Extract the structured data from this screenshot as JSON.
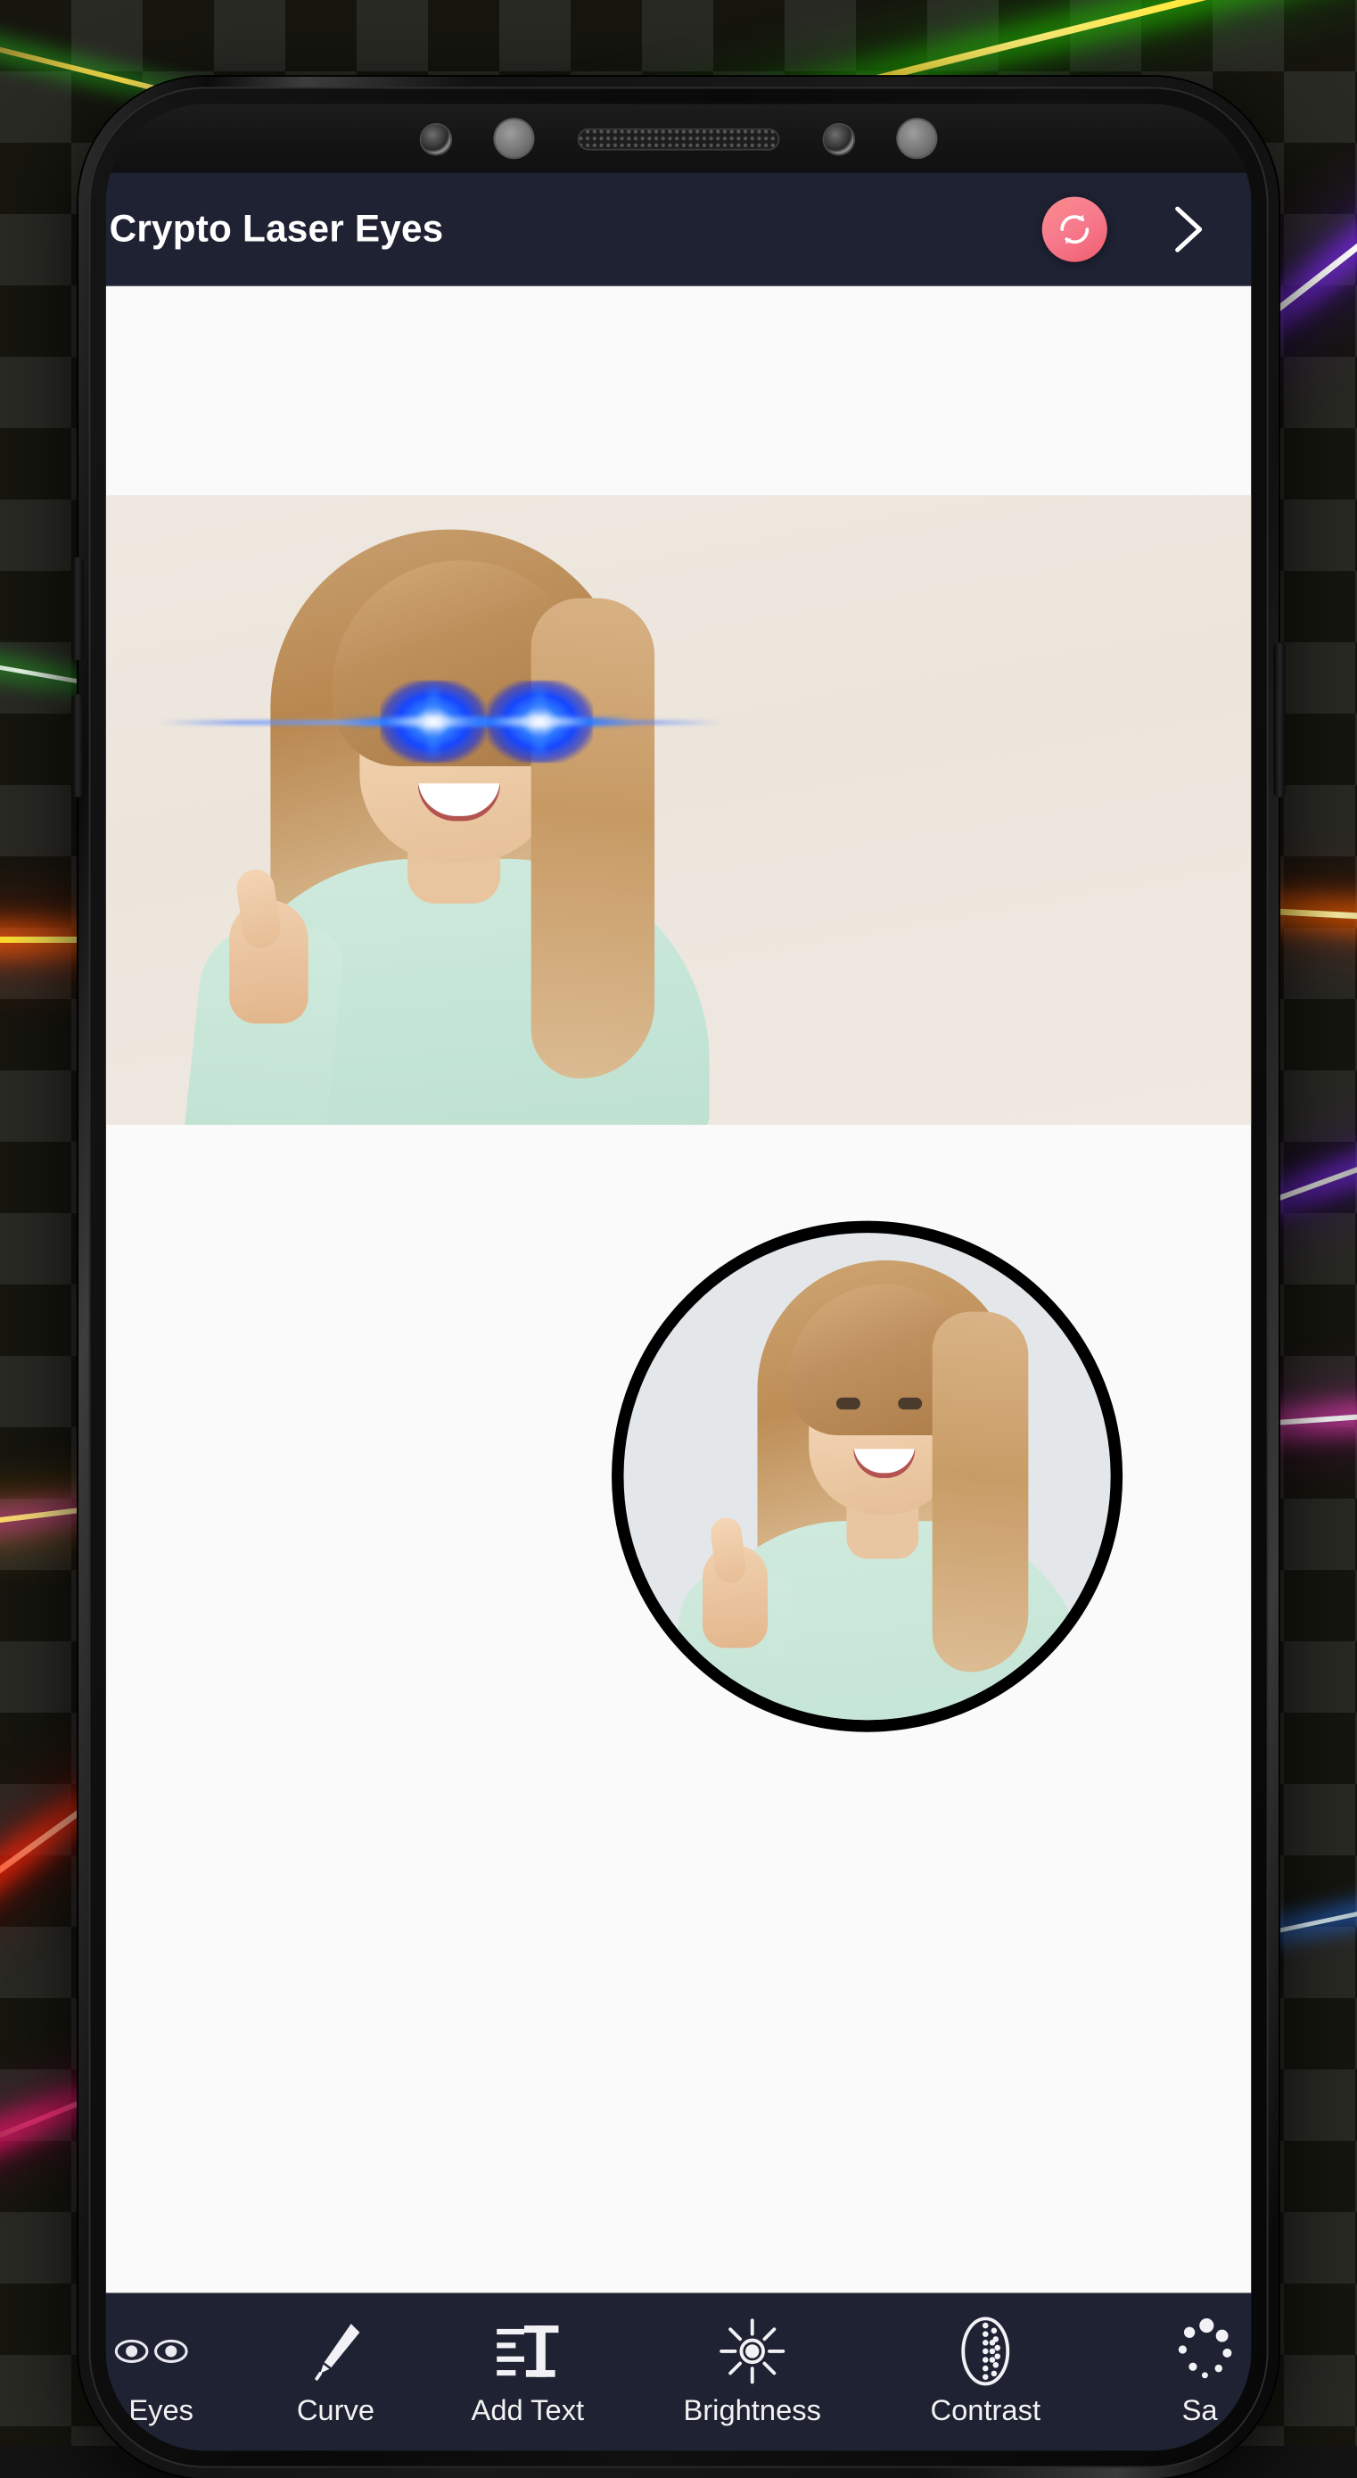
{
  "app": {
    "title": "Crypto Laser Eyes",
    "header_bg": "#1f2233",
    "refresh_color": "#f4707f",
    "accent": "#ef5f6f"
  },
  "header": {
    "title": "Crypto Laser Eyes",
    "refresh_icon": "refresh-icon",
    "next_icon": "chevron-right-icon",
    "refresh_label": "Refresh",
    "next_label": "Next"
  },
  "device": {
    "bezel_sensors": [
      "camera-sensor",
      "proximity-sensor",
      "earpiece-speaker",
      "camera-sensor",
      "light-sensor"
    ]
  },
  "canvas": {
    "background": "#fafafa",
    "photo_background": "#ece5dc",
    "effect": "laser-eyes",
    "effect_color": "#1546ff"
  },
  "thumbnail": {
    "name": "original-photo-preview",
    "border_color": "#000000"
  },
  "toolbar": {
    "background": "#1f2233",
    "items": [
      {
        "label": "Laser Eyes",
        "icon": "eyes-icon",
        "visible_label": "r Eyes"
      },
      {
        "label": "Curve",
        "icon": "pen-icon",
        "visible_label": "Curve"
      },
      {
        "label": "Add Text",
        "icon": "text-icon",
        "visible_label": "Add Text"
      },
      {
        "label": "Brightness",
        "icon": "brightness-icon",
        "visible_label": "Brightness"
      },
      {
        "label": "Contrast",
        "icon": "contrast-icon",
        "visible_label": "Contrast"
      },
      {
        "label": "Saturation",
        "icon": "saturation-icon",
        "visible_label": "Sa"
      }
    ]
  },
  "background": {
    "pattern": "checkerboard",
    "laser_colors": [
      "#ffe000",
      "#22c000",
      "#8a2be2",
      "#ffffff",
      "#ff3b1f",
      "#ff9a00",
      "#e040a0",
      "#ff1f6b"
    ]
  }
}
